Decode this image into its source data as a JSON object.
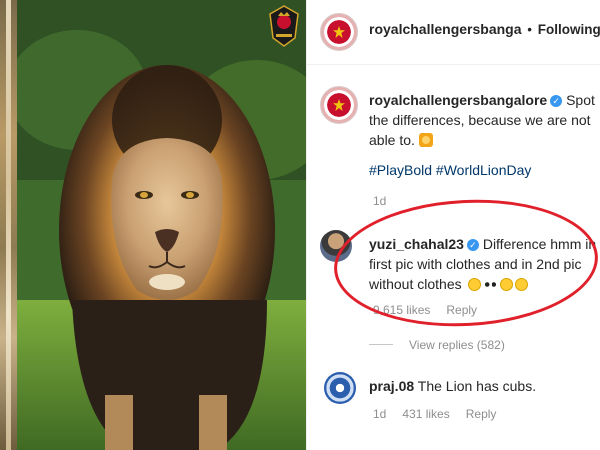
{
  "post": {
    "account": "royalchallengersbanga",
    "separator": "•",
    "follow_status": "Following"
  },
  "caption": {
    "username": "royalchallengersbangalore",
    "text": "Spot the differences, because we are not able to.",
    "hashtags": "#PlayBold #WorldLionDay",
    "time": "1d"
  },
  "comments": [
    {
      "username": "yuzi_chahal23",
      "text": "Difference hmm in first pic with clothes and in 2nd pic without clothes",
      "likes": "9,615 likes",
      "reply": "Reply",
      "view_replies": "View replies (582)"
    },
    {
      "username": "praj.08",
      "text": "The Lion has cubs.",
      "time": "1d",
      "likes": "431 likes",
      "reply": "Reply"
    }
  ],
  "colors": {
    "accent_link": "#00376b",
    "verified": "#3897f0",
    "highlight": "#e0202a",
    "meta_gray": "#8e8e8e"
  },
  "icons": [
    "verified-badge-icon",
    "lion-emoji-icon",
    "thinking-emoji-icon",
    "eyes-emoji-icon",
    "flushed-emoji-icon",
    "relieved-emoji-icon"
  ]
}
